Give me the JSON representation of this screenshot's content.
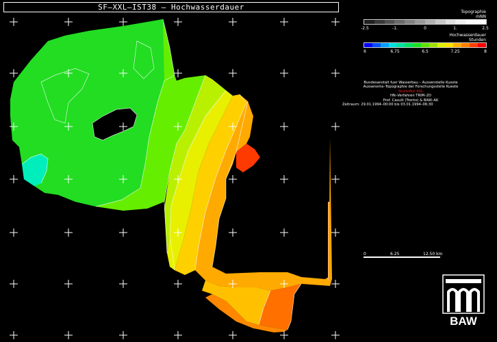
{
  "title": "SF–XXL–IST38 – Hochwasserdauer",
  "legend_topo": {
    "title_line1": "Topographie",
    "title_line2": "mNN",
    "ticks": [
      "-2.5",
      "-1.",
      "0",
      "1.",
      "2.5"
    ],
    "colors": [
      "#202020",
      "#383838",
      "#505050",
      "#686868",
      "#808080",
      "#989898",
      "#b0b0b0",
      "#c8c8c8",
      "#e0e0e0",
      "#f0f0f0",
      "#fafafa",
      "#ffffff"
    ]
  },
  "legend_dauer": {
    "title_line1": "Hochwasserdauer",
    "title_line2": "Stunden",
    "ticks": [
      "6",
      "6.75",
      "6.5",
      "7.25",
      "8"
    ],
    "colors": [
      "#0000ff",
      "#0050ff",
      "#00a0ff",
      "#00e0e0",
      "#00e0a0",
      "#00e060",
      "#20e020",
      "#60e000",
      "#a0e000",
      "#e0f000",
      "#ffe000",
      "#ffb000",
      "#ff8000",
      "#ff4000",
      "#ff0000"
    ]
  },
  "info": {
    "line1": "Bundesanstalt fuer Wasserbau – Aussenstelle Kueste",
    "line2": "Aussenems–Topographie der Forschungsstelle Kueste",
    "line3": "Sturmflut XXL",
    "line4": "HN–Verfahren TRIM–2D",
    "line5": "Prof. Casulli (Trento) & BAW–AK",
    "line6": "Zeitraum: 29.01.1994–00:00 bis 03.01.1994–06:30"
  },
  "scale": {
    "labels": [
      "0",
      "6.25",
      "12.50 km"
    ]
  },
  "logo": {
    "text": "BAW"
  }
}
